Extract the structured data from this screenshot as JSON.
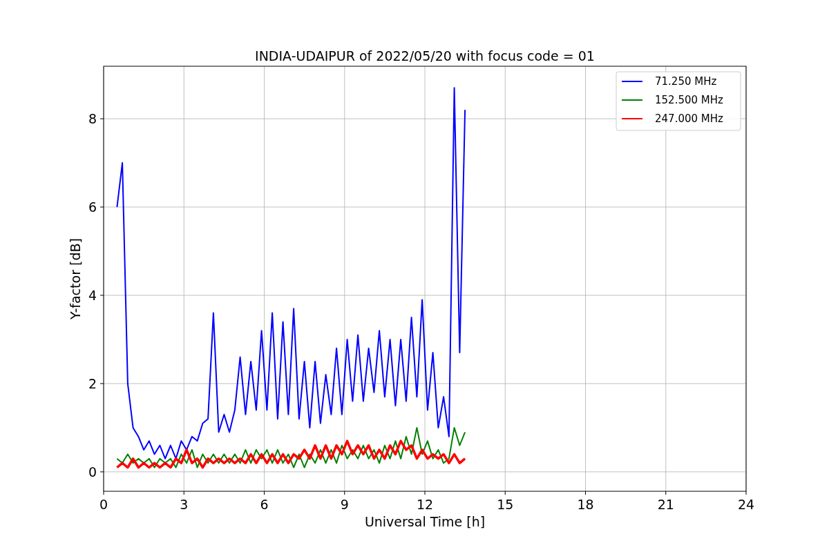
{
  "chart_data": {
    "type": "line",
    "title": "INDIA-UDAIPUR of 2022/05/20 with focus code = 01",
    "xlabel": "Universal Time [h]",
    "ylabel": "Y-factor [dB]",
    "xlim": [
      0,
      24
    ],
    "ylim": [
      -0.44,
      9.19
    ],
    "xticks": [
      0,
      3,
      6,
      9,
      12,
      15,
      18,
      21,
      24
    ],
    "yticks": [
      0,
      2,
      4,
      6,
      8
    ],
    "grid": true,
    "legend": true,
    "x": [
      0.5,
      0.7,
      0.9,
      1.1,
      1.3,
      1.5,
      1.7,
      1.9,
      2.1,
      2.3,
      2.5,
      2.7,
      2.9,
      3.1,
      3.3,
      3.5,
      3.7,
      3.9,
      4.1,
      4.3,
      4.5,
      4.7,
      4.9,
      5.1,
      5.3,
      5.5,
      5.7,
      5.9,
      6.1,
      6.3,
      6.5,
      6.7,
      6.9,
      7.1,
      7.3,
      7.5,
      7.7,
      7.9,
      8.1,
      8.3,
      8.5,
      8.7,
      8.9,
      9.1,
      9.3,
      9.5,
      9.7,
      9.9,
      10.1,
      10.3,
      10.5,
      10.7,
      10.9,
      11.1,
      11.3,
      11.5,
      11.7,
      11.9,
      12.1,
      12.3,
      12.5,
      12.7,
      12.9,
      13.1,
      13.3,
      13.5
    ],
    "series": [
      {
        "name": "71.250 MHz",
        "color": "#0000ff",
        "values": [
          6.0,
          7.0,
          2.0,
          1.0,
          0.8,
          0.5,
          0.7,
          0.4,
          0.6,
          0.3,
          0.6,
          0.3,
          0.7,
          0.5,
          0.8,
          0.7,
          1.1,
          1.2,
          3.6,
          0.9,
          1.3,
          0.9,
          1.4,
          2.6,
          1.3,
          2.5,
          1.4,
          3.2,
          1.4,
          3.6,
          1.2,
          3.4,
          1.3,
          3.7,
          1.2,
          2.5,
          1.0,
          2.5,
          1.1,
          2.2,
          1.3,
          2.8,
          1.3,
          3.0,
          1.6,
          3.1,
          1.6,
          2.8,
          1.8,
          3.2,
          1.7,
          3.0,
          1.5,
          3.0,
          1.6,
          3.5,
          1.7,
          3.9,
          1.4,
          2.7,
          1.0,
          1.7,
          0.8,
          8.7,
          2.7,
          8.2
        ]
      },
      {
        "name": "152.500 MHz",
        "color": "#008000",
        "values": [
          0.3,
          0.2,
          0.4,
          0.2,
          0.3,
          0.2,
          0.3,
          0.1,
          0.3,
          0.2,
          0.3,
          0.1,
          0.4,
          0.2,
          0.5,
          0.1,
          0.4,
          0.2,
          0.4,
          0.2,
          0.4,
          0.2,
          0.4,
          0.2,
          0.5,
          0.2,
          0.5,
          0.3,
          0.5,
          0.2,
          0.5,
          0.2,
          0.4,
          0.1,
          0.4,
          0.1,
          0.4,
          0.2,
          0.5,
          0.2,
          0.5,
          0.2,
          0.6,
          0.3,
          0.5,
          0.3,
          0.6,
          0.3,
          0.5,
          0.2,
          0.6,
          0.3,
          0.7,
          0.3,
          0.8,
          0.4,
          1.0,
          0.4,
          0.7,
          0.3,
          0.5,
          0.2,
          0.3,
          1.0,
          0.6,
          0.9
        ]
      },
      {
        "name": "247.000 MHz",
        "color": "#ff0000",
        "values": [
          0.1,
          0.2,
          0.1,
          0.3,
          0.1,
          0.2,
          0.1,
          0.2,
          0.1,
          0.2,
          0.1,
          0.3,
          0.2,
          0.5,
          0.2,
          0.3,
          0.1,
          0.3,
          0.2,
          0.3,
          0.2,
          0.3,
          0.2,
          0.3,
          0.2,
          0.4,
          0.2,
          0.4,
          0.2,
          0.4,
          0.2,
          0.4,
          0.2,
          0.4,
          0.3,
          0.5,
          0.3,
          0.6,
          0.3,
          0.6,
          0.3,
          0.6,
          0.4,
          0.7,
          0.4,
          0.6,
          0.4,
          0.6,
          0.3,
          0.5,
          0.3,
          0.6,
          0.4,
          0.7,
          0.5,
          0.6,
          0.3,
          0.5,
          0.3,
          0.4,
          0.3,
          0.4,
          0.2,
          0.4,
          0.2,
          0.3
        ]
      }
    ]
  }
}
